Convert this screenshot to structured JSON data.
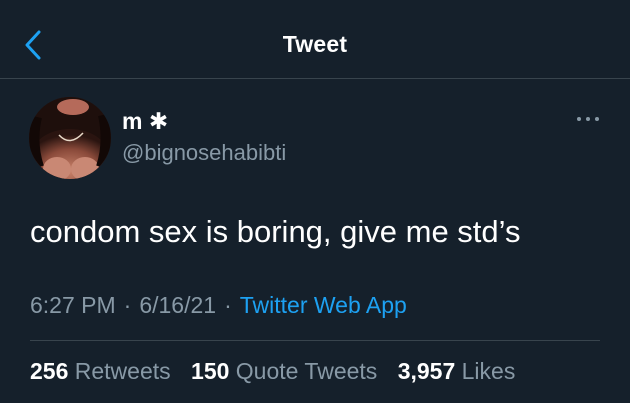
{
  "colors": {
    "background": "#15202b",
    "text": "#ffffff",
    "secondary_text": "#8899a6",
    "accent": "#1da1f2",
    "divider": "#38444d"
  },
  "header": {
    "title": "Tweet",
    "back_icon": "chevron-left-icon"
  },
  "tweet": {
    "avatar_icon": "avatar",
    "display_name": "m",
    "name_suffix": "✱",
    "handle": "@bignosehabibti",
    "more_icon": "more-horizontal-icon",
    "text": "condom sex is boring, give me std’s",
    "time": "6:27 PM",
    "date": "6/16/21",
    "separator": "·",
    "source": "Twitter Web App"
  },
  "stats": [
    {
      "count": "256",
      "label": "Retweets"
    },
    {
      "count": "150",
      "label": "Quote Tweets"
    },
    {
      "count": "3,957",
      "label": "Likes"
    }
  ]
}
